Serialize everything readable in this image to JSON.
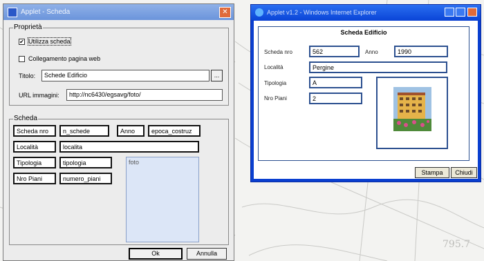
{
  "dialog": {
    "title": "Applet - Scheda",
    "properties_group": "Proprietà",
    "use_card_label": "Utilizza scheda",
    "use_card_checked": true,
    "web_link_label": "Collegamento pagina web",
    "web_link_checked": false,
    "title_label": "Titolo:",
    "title_value": "Schede Edificio",
    "browse_label": "...",
    "url_label": "URL immagini:",
    "url_value": "http://nc6430/egsavg/foto/",
    "card_group": "Scheda",
    "fields": [
      {
        "label": "Scheda nro",
        "value": "n_schede"
      },
      {
        "label": "Anno",
        "value": "epoca_costruz"
      },
      {
        "label": "Località",
        "value": "localita"
      },
      {
        "label": "Tipologia",
        "value": "tipologia"
      },
      {
        "label": "Nro Piani",
        "value": "numero_piani"
      }
    ],
    "photo_field": "foto",
    "ok_label": "Ok",
    "cancel_label": "Annulla"
  },
  "ie_window": {
    "title": "Applet v1.2 - Windows Internet Explorer",
    "card_title": "Scheda Edificio",
    "rows": [
      {
        "label": "Scheda nro",
        "value": "562"
      },
      {
        "label": "Anno",
        "value": "1990"
      },
      {
        "label": "Località",
        "value": "Pergine"
      },
      {
        "label": "Tipologia",
        "value": "A"
      },
      {
        "label": "Nro Piani",
        "value": "2"
      }
    ],
    "print_label": "Stampa",
    "close_label": "Chiudi"
  },
  "colors": {
    "accent": "#0b46d8",
    "field_border": "#2b4f8f"
  }
}
